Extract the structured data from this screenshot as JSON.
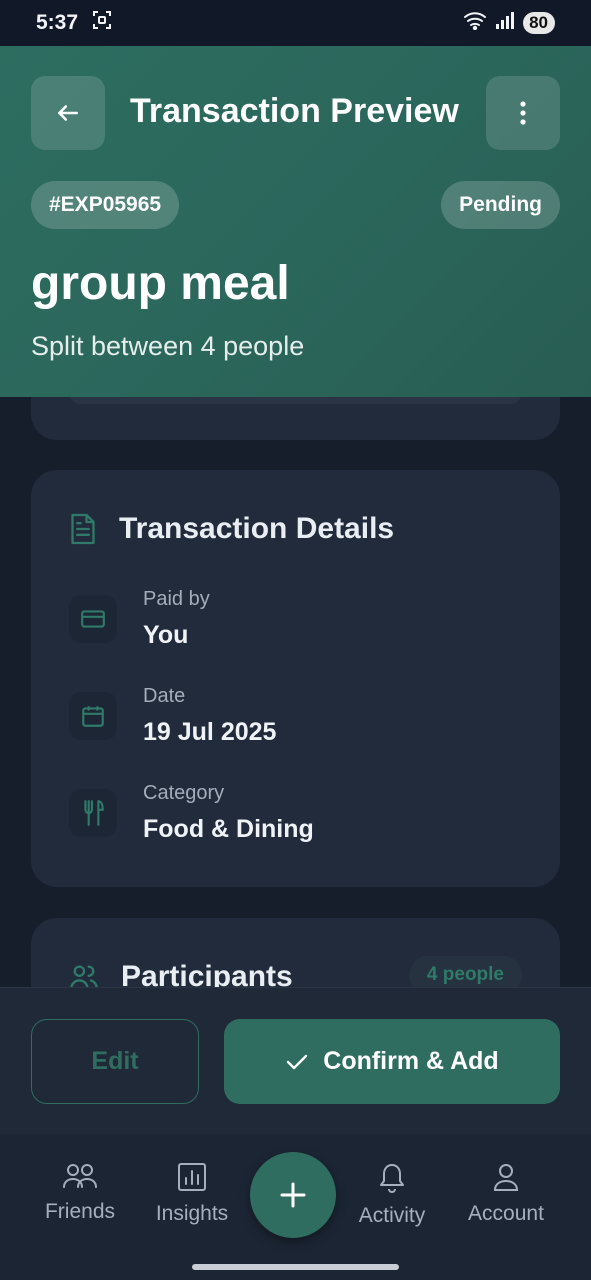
{
  "status_bar": {
    "time": "5:37",
    "battery": "80"
  },
  "header": {
    "title": "Transaction Preview",
    "id_chip": "#EXP05965",
    "status_chip": "Pending",
    "name": "group meal",
    "subtitle": "Split between 4 people"
  },
  "details": {
    "title": "Transaction Details",
    "rows": [
      {
        "label": "Paid by",
        "value": "You",
        "icon": "card-icon"
      },
      {
        "label": "Date",
        "value": "19 Jul 2025",
        "icon": "calendar-icon"
      },
      {
        "label": "Category",
        "value": "Food & Dining",
        "icon": "utensils-icon"
      }
    ]
  },
  "participants": {
    "title": "Participants",
    "count": "4 people"
  },
  "actions": {
    "edit": "Edit",
    "confirm": "Confirm & Add"
  },
  "nav": {
    "friends": "Friends",
    "insights": "Insights",
    "activity": "Activity",
    "account": "Account"
  },
  "colors": {
    "accent": "#2f6d60",
    "header": "#2b665b",
    "background": "#161d2b",
    "card": "#222b3b"
  }
}
